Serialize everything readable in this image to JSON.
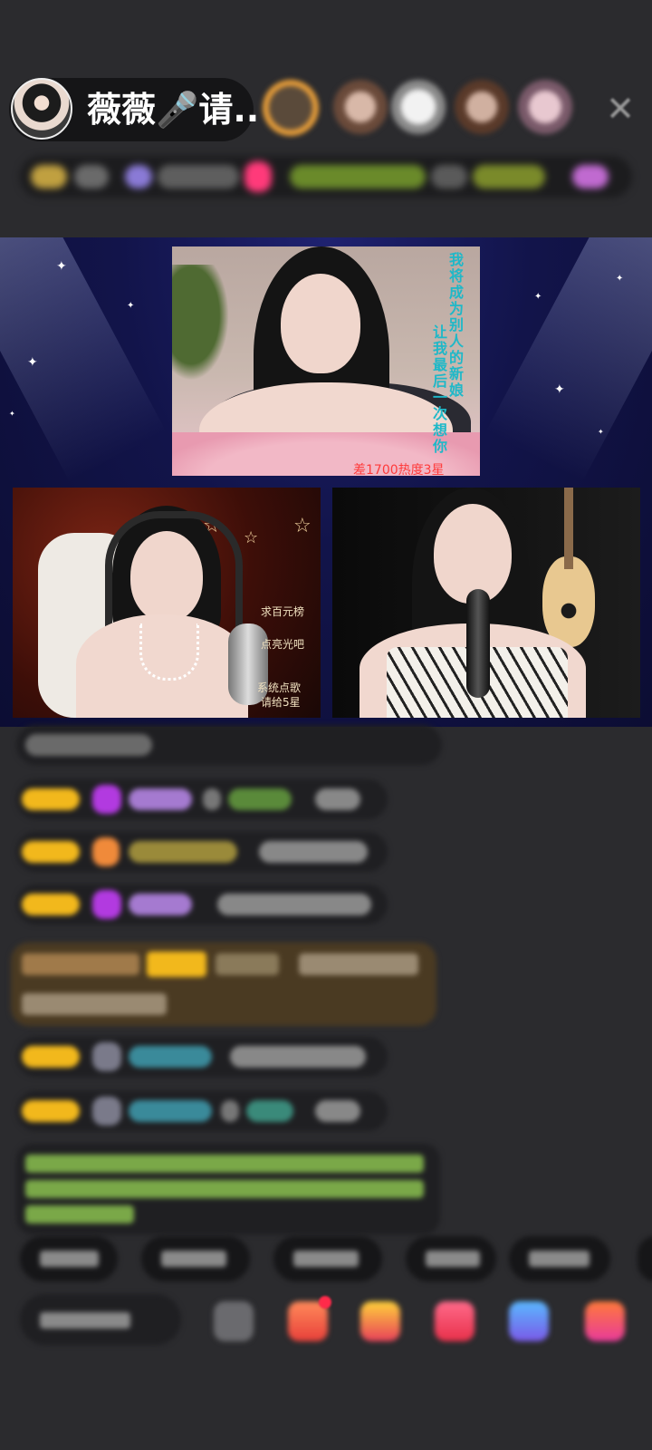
{
  "header": {
    "host_name": "薇薇🎤请...",
    "viewers": [
      {
        "color": "#c98a4a"
      },
      {
        "color": "#b48c7c"
      },
      {
        "color": "#d9d2cc"
      },
      {
        "color": "#9a7a6a"
      },
      {
        "color": "#c9a6b0"
      }
    ]
  },
  "stage": {
    "top_video": {
      "vertical_lines": [
        "我将成为别人的新娘",
        "让我最后一次想你"
      ],
      "heat_text": "差1700热度3星"
    },
    "left_video": {
      "overlay_lines": [
        "求百元榜",
        "点亮光吧",
        "系统点歌",
        "请给5星"
      ]
    }
  },
  "colors": {
    "accent_gold": "#f2b81c",
    "username_purple": "#b487d6",
    "username_cyan": "#3fb6c8",
    "message_green": "#9ccf5a",
    "gift_red": "#ff3a3a"
  }
}
